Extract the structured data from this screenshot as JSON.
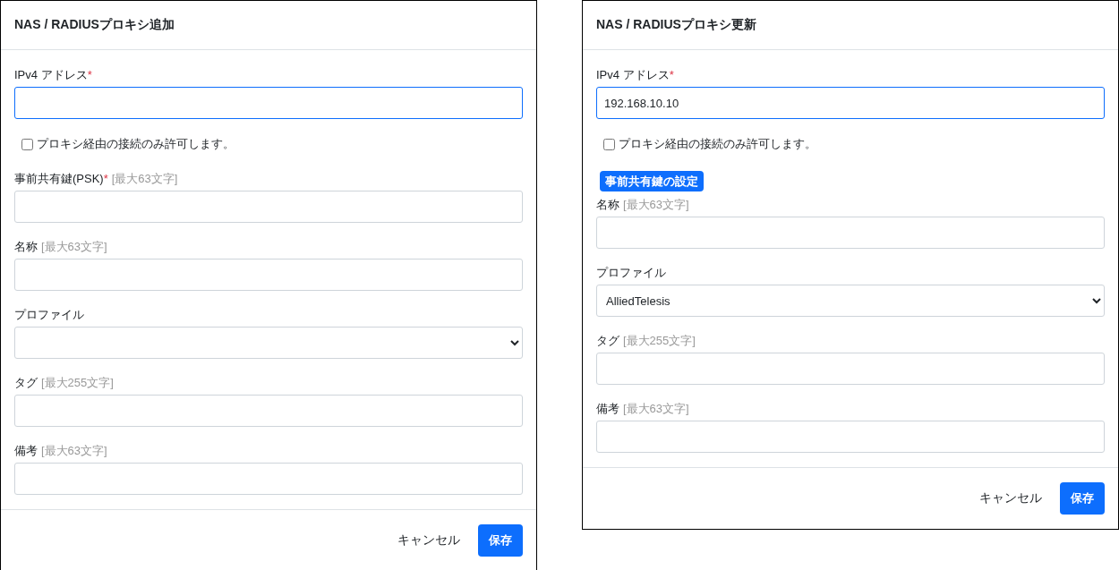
{
  "dialogs": [
    {
      "title": "NAS / RADIUSプロキシ追加",
      "fields": [
        {
          "kind": "text",
          "label": "IPv4 アドレス",
          "required_mark": "*",
          "focused": true
        },
        {
          "kind": "checkbox",
          "label": "プロキシ経由の接続のみ許可します。",
          "checked": false
        },
        {
          "kind": "text",
          "label": "事前共有鍵(PSK)",
          "required_mark": "*",
          "hint": "[最大63文字]",
          "focused": false
        },
        {
          "kind": "text",
          "label": "名称",
          "hint": "[最大63文字]",
          "focused": false
        },
        {
          "kind": "select",
          "label": "プロファイル",
          "focused": false
        },
        {
          "kind": "text",
          "label": "タグ",
          "hint": "[最大255文字]",
          "focused": false
        },
        {
          "kind": "text",
          "label": "備考",
          "hint": "[最大63文字]",
          "focused": false
        }
      ],
      "cancel": "キャンセル",
      "save": "保存"
    },
    {
      "title": "NAS / RADIUSプロキシ更新",
      "fields": [
        {
          "kind": "text",
          "label": "IPv4 アドレス",
          "required_mark": "*",
          "value": "192.168.10.10",
          "focused": true
        },
        {
          "kind": "checkbox",
          "label": "プロキシ経由の接続のみ許可します。",
          "checked": false
        },
        {
          "kind": "button",
          "label": "事前共有鍵の設定"
        },
        {
          "kind": "text",
          "label": "名称",
          "hint": "[最大63文字]",
          "focused": false
        },
        {
          "kind": "select",
          "label": "プロファイル",
          "value": "AlliedTelesis",
          "focused": false
        },
        {
          "kind": "text",
          "label": "タグ",
          "hint": "[最大255文字]",
          "focused": false
        },
        {
          "kind": "text",
          "label": "備考",
          "hint": "[最大63文字]",
          "focused": false
        }
      ],
      "cancel": "キャンセル",
      "save": "保存"
    }
  ]
}
